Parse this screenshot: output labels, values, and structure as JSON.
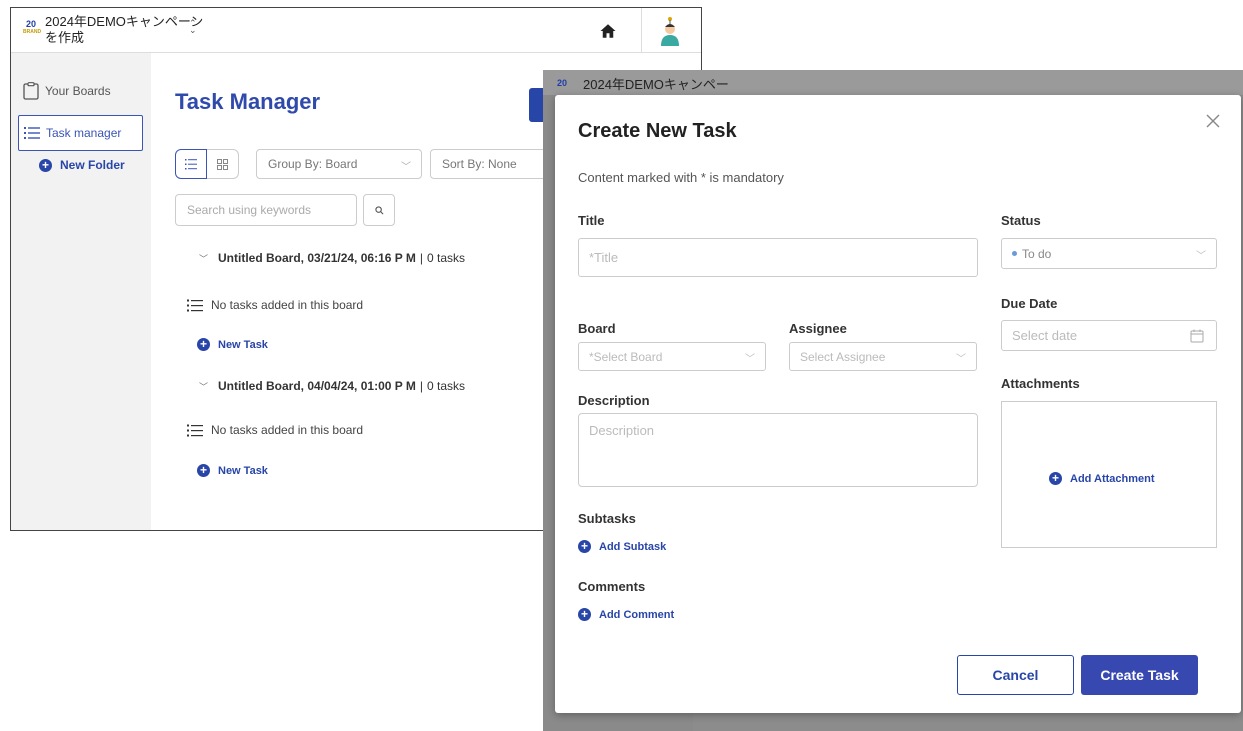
{
  "window": {
    "app_title": "2024年DEMOキャンペーンを作成",
    "logo_text": "20",
    "logo_sub": "BRAND"
  },
  "sidebar": {
    "items": [
      {
        "label": "Your Boards",
        "icon": "clipboard-icon"
      },
      {
        "label": "Task manager",
        "icon": "list-icon"
      }
    ],
    "new_folder": "New Folder"
  },
  "main": {
    "title": "Task Manager",
    "group_by": "Group By: Board",
    "sort_by": "Sort By: None",
    "search_placeholder": "Search using keywords",
    "boards": [
      {
        "name": "Untitled Board, 03/21/24, 06:16 P M",
        "count": "0 tasks",
        "empty_text": "No tasks added in this board",
        "new_task": "New Task"
      },
      {
        "name": "Untitled Board, 04/04/24, 01:00 P M",
        "count": "0 tasks",
        "empty_text": "No tasks added in this board",
        "new_task": "New Task"
      }
    ]
  },
  "second_window": {
    "title": "2024年DEMOキャンペー"
  },
  "modal": {
    "title": "Create New Task",
    "note": "Content marked with * is mandatory",
    "title_label": "Title",
    "title_placeholder": "*Title",
    "status_label": "Status",
    "status_value": "To do",
    "due_date_label": "Due Date",
    "due_date_placeholder": "Select date",
    "board_label": "Board",
    "board_placeholder": "*Select Board",
    "assignee_label": "Assignee",
    "assignee_placeholder": "Select Assignee",
    "attachments_label": "Attachments",
    "add_attachment": "Add Attachment",
    "description_label": "Description",
    "description_placeholder": "Description",
    "subtasks_label": "Subtasks",
    "add_subtask": "Add Subtask",
    "comments_label": "Comments",
    "add_comment": "Add Comment",
    "cancel": "Cancel",
    "create": "Create Task"
  },
  "colors": {
    "accent": "#2845a8",
    "button_primary": "#3749b0",
    "overlay": "#8c8c8c"
  }
}
